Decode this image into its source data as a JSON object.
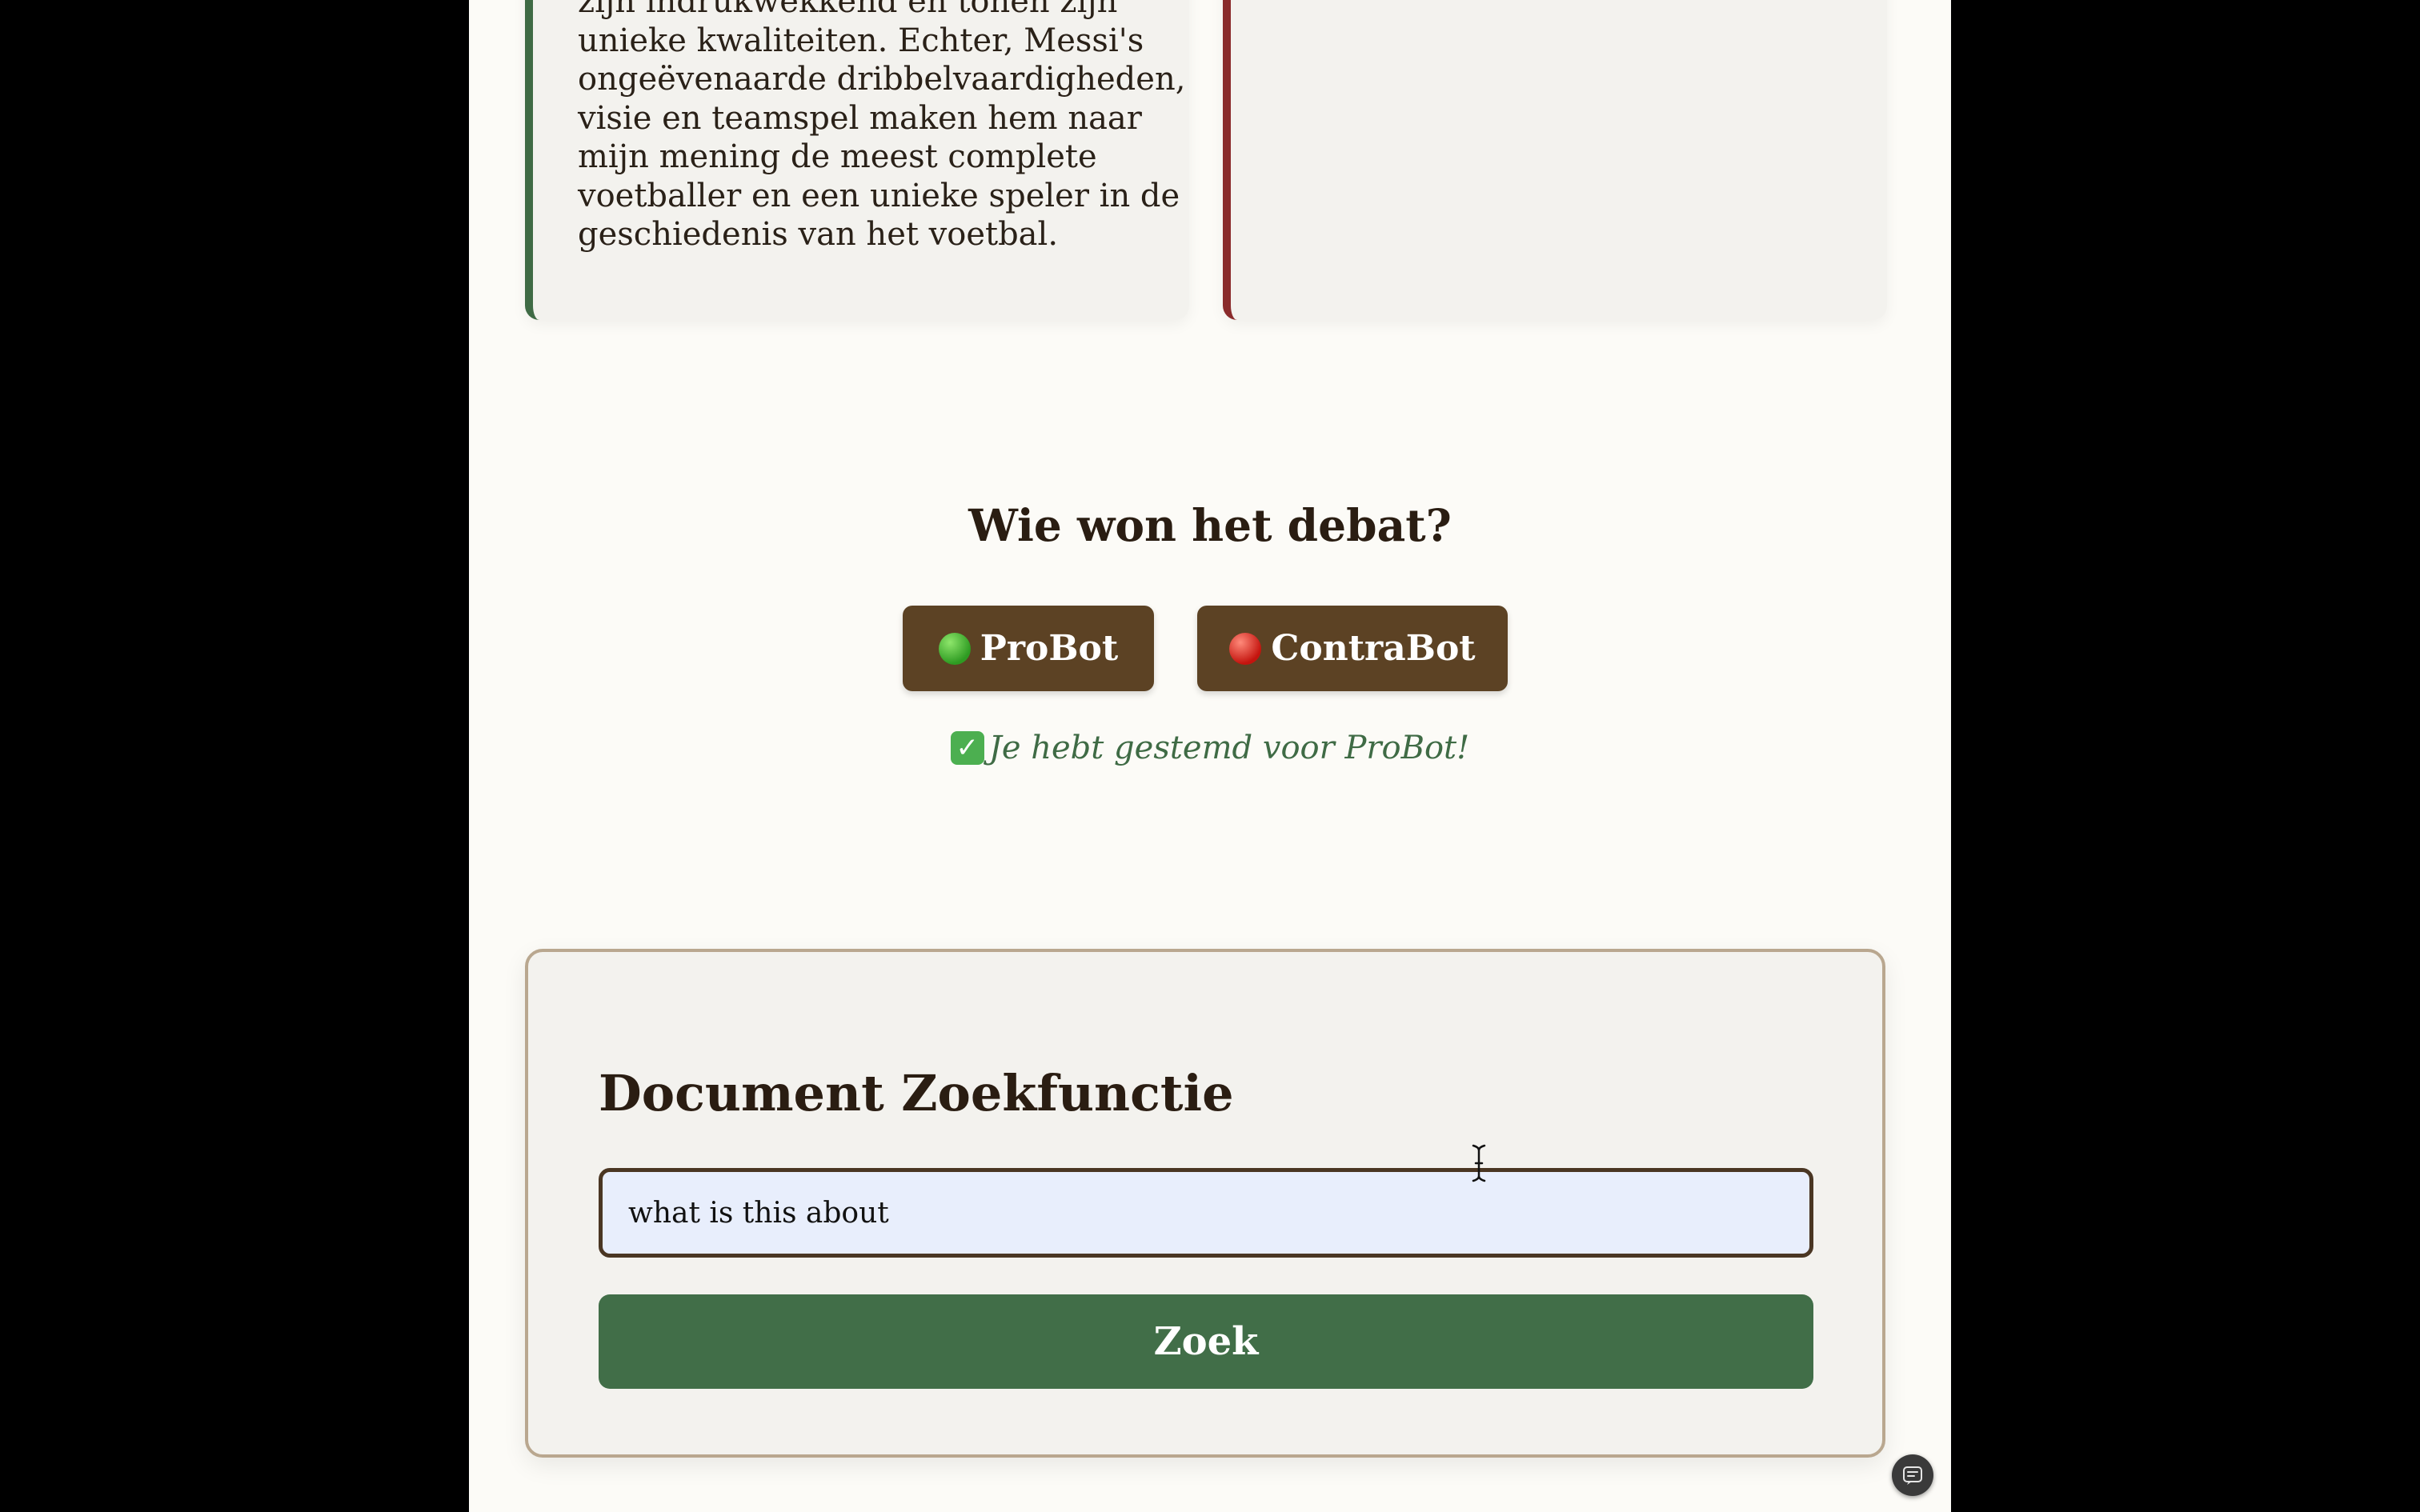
{
  "debate": {
    "pro_argument_lines": [
      "zijn indrukwekkend en tonen zijn",
      "unieke kwaliteiten. Echter, Messi's",
      "ongeëvenaarde dribbelvaardigheden,",
      "visie en teamspel maken hem naar",
      "mijn mening de meest complete",
      "voetballer en een unieke speler in de",
      "geschiedenis van het voetbal."
    ],
    "pro_color": "#3f6b45",
    "contra_color": "#8a2b2b"
  },
  "vote": {
    "title": "Wie won het debat?",
    "pro_label": "ProBot",
    "contra_label": "ContraBot",
    "result_message": "Je hebt gestemd voor ProBot!",
    "result_icon": "check-mark-icon",
    "button_color": "#5c4224"
  },
  "search": {
    "title": "Document Zoekfunctie",
    "input_value": "what is this about",
    "button_label": "Zoek",
    "button_color": "#416e48"
  },
  "icons": {
    "pro_dot": "green-circle-icon",
    "contra_dot": "red-circle-icon",
    "assistant": "assistant-icon"
  }
}
